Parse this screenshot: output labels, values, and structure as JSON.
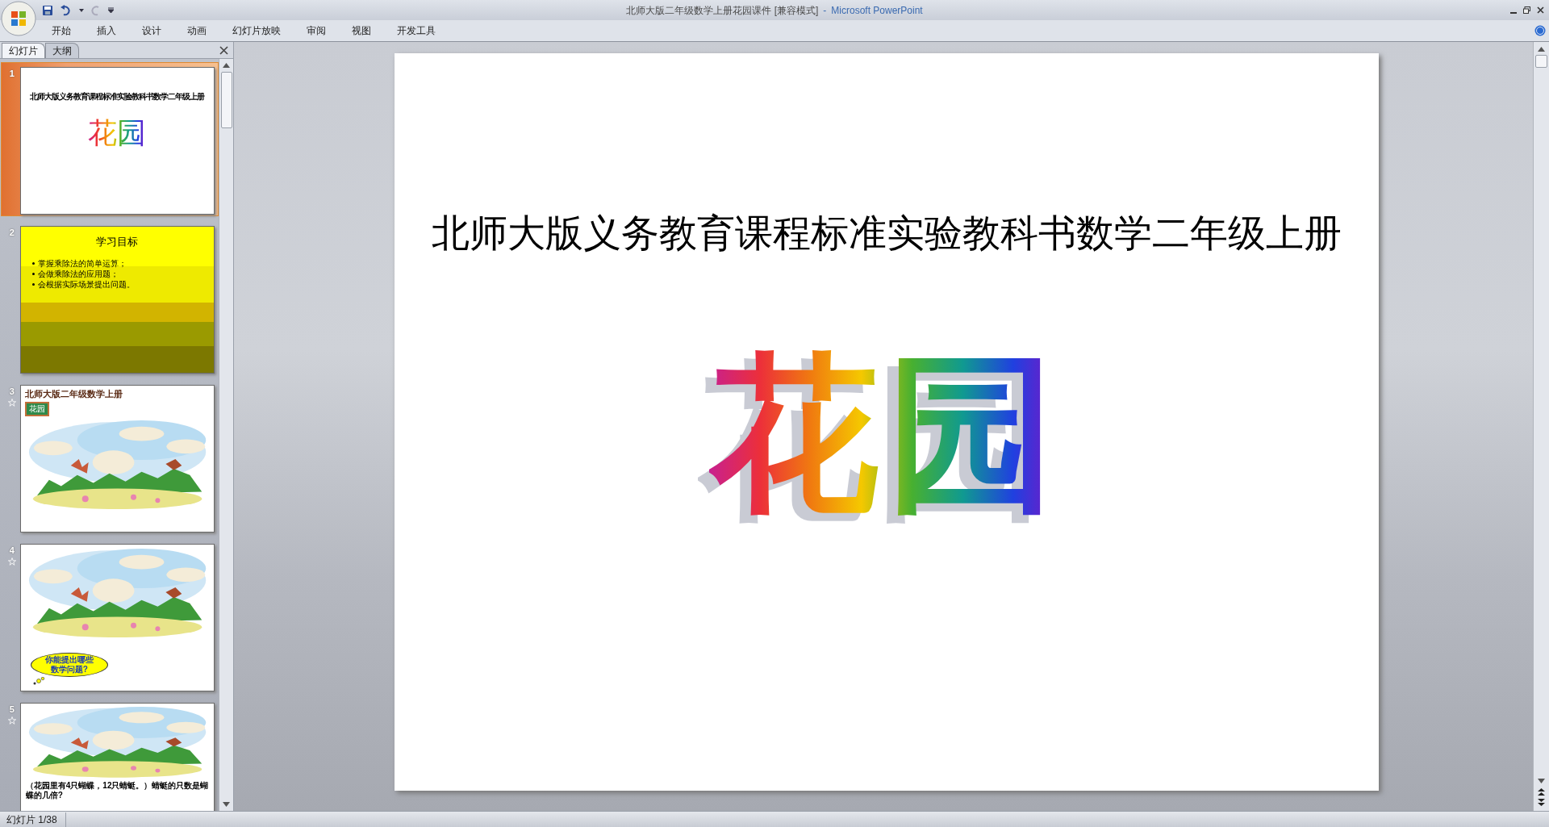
{
  "window": {
    "title": "北师大版二年级数学上册花园课件 [兼容模式]",
    "separator": "-",
    "app": "Microsoft PowerPoint"
  },
  "ribbon_tabs": [
    "开始",
    "插入",
    "设计",
    "动画",
    "幻灯片放映",
    "审阅",
    "视图",
    "开发工具"
  ],
  "panel_tabs": [
    {
      "label": "幻灯片",
      "selected": true
    },
    {
      "label": "大纲",
      "selected": false
    }
  ],
  "thumbnails": [
    {
      "number": "1",
      "selected": true,
      "animated": false,
      "kind": "title",
      "title": "北师大版义务教育课程标准实验教科书数学二年级上册",
      "heading": "花园"
    },
    {
      "number": "2",
      "selected": false,
      "animated": false,
      "kind": "objectives",
      "title": "学习目标",
      "bullets": [
        "掌握乘除法的简单运算；",
        "会做乘除法的应用题；",
        "会根据实际场景提出问题。"
      ]
    },
    {
      "number": "3",
      "selected": false,
      "animated": true,
      "kind": "scene",
      "title": "北师大版二年级数学上册",
      "badge": "花园"
    },
    {
      "number": "4",
      "selected": false,
      "animated": true,
      "kind": "scene",
      "callout": "你能提出哪些数学问题?"
    },
    {
      "number": "5",
      "selected": false,
      "animated": true,
      "kind": "scene",
      "caption": "（花园里有4只蝴蝶，12只蜻蜓。）蜻蜓的只数是蝴蝶的几倍?"
    }
  ],
  "slide": {
    "title": "北师大版义务教育课程标准实验教科书数学二年级上册",
    "heading": "花园"
  },
  "status_bar": {
    "slide_counter": "幻灯片 1/38"
  }
}
